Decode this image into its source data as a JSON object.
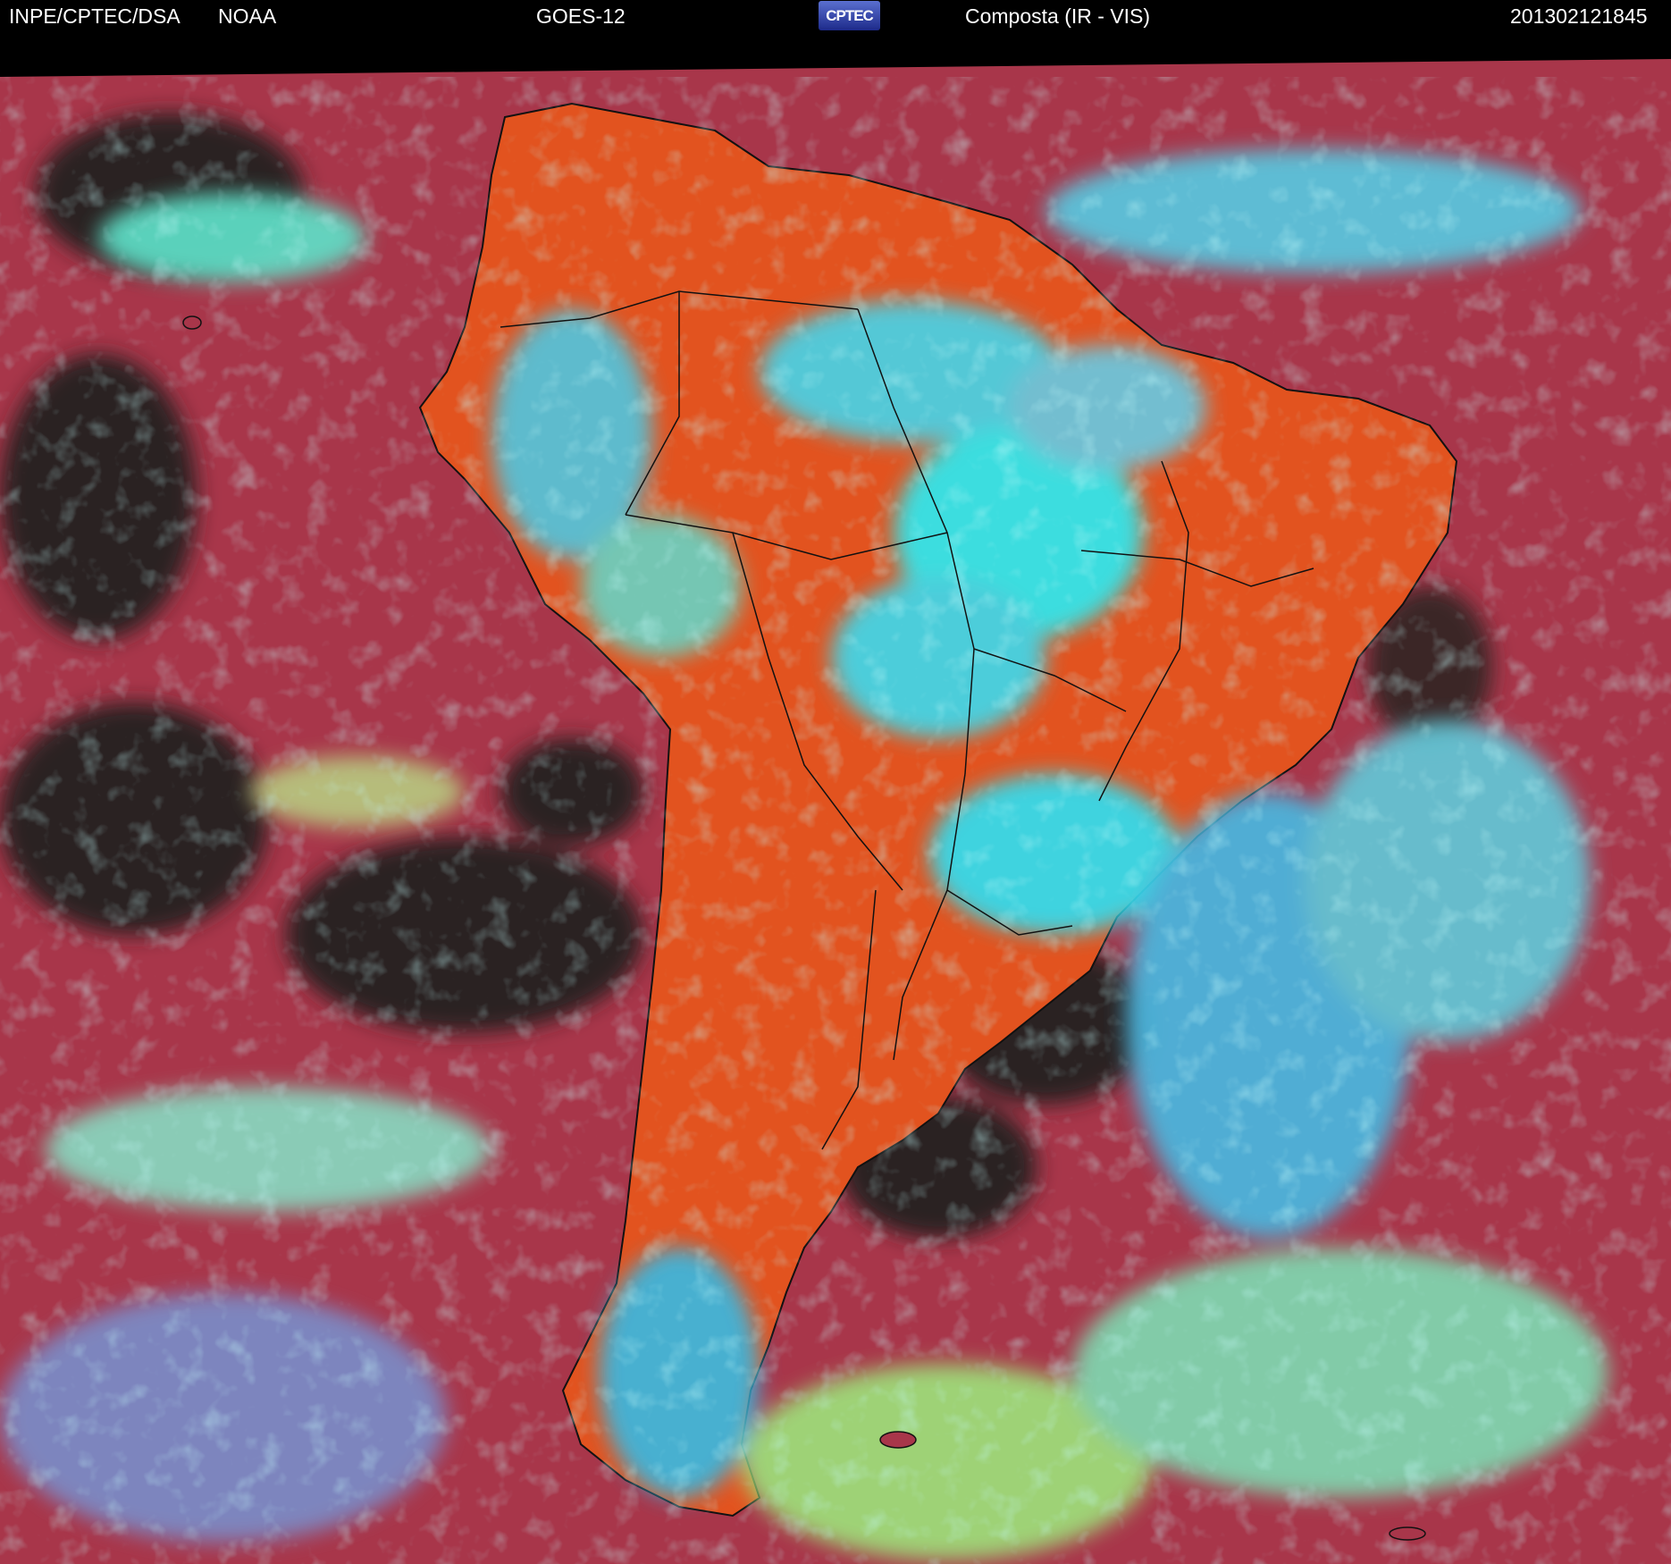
{
  "header": {
    "institution": "INPE/CPTEC/DSA",
    "agency": "NOAA",
    "satellite": "GOES-12",
    "logo_text": "CPTEC",
    "product": "Composta (IR - VIS)",
    "timestamp": "201302121845"
  },
  "palette": {
    "ocean_clear": "#a8364a",
    "land_clear": "#e8531e",
    "cold_cloud": "#2de9f0",
    "mid_cloud": "#8ee06a",
    "low_cloud": "#4aa0d8",
    "dark_ocean": "#2a2424",
    "border": "#111111"
  }
}
